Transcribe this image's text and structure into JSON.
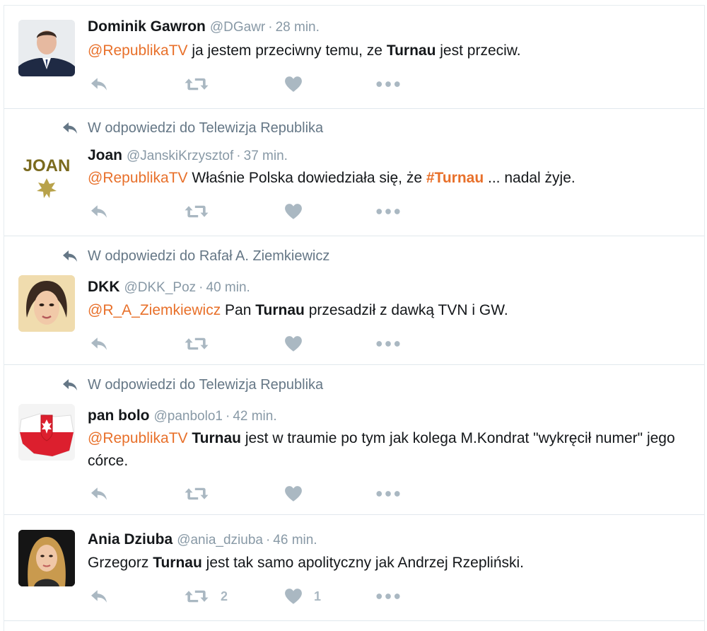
{
  "colors": {
    "accent": "#e8702a",
    "muted": "#8899a6",
    "icon": "#aab8c2",
    "divider": "#e1e8ed",
    "text": "#14171a"
  },
  "icons": {
    "reply": "reply-icon",
    "retweet": "retweet-icon",
    "like": "heart-icon",
    "more": "more-icon"
  },
  "tweets": [
    {
      "context": "",
      "fullname": "Dominik Gawron",
      "username": "@DGawr",
      "separator": "·",
      "time": "28 min.",
      "text": {
        "mention": "@RepublikaTV",
        "part1": " ja jestem przeciwny temu, ze ",
        "bold": "Turnau",
        "part2": " jest przeciw."
      },
      "retweets": "",
      "likes": ""
    },
    {
      "context": "W odpowiedzi do Telewizja Republika",
      "fullname": "Joan",
      "username": "@JanskiKrzysztof",
      "separator": "·",
      "time": "37 min.",
      "avatar_text": "JOAN",
      "text": {
        "mention": "@RepublikaTV",
        "part1": " Właśnie Polska dowiedziała się, że ",
        "hashtag": "#Turnau",
        "part2": " ... nadal żyje."
      },
      "retweets": "",
      "likes": ""
    },
    {
      "context": "W odpowiedzi do Rafał A. Ziemkiewicz",
      "fullname": "DKK",
      "username": "@DKK_Poz",
      "separator": "·",
      "time": "40 min.",
      "text": {
        "mention": "@R_A_Ziemkiewicz",
        "part1": " Pan ",
        "bold": "Turnau",
        "part2": " przesadził z dawką TVN i GW."
      },
      "retweets": "",
      "likes": ""
    },
    {
      "context": "W odpowiedzi do Telewizja Republika",
      "fullname": "pan bolo",
      "username": "@panbolo1",
      "separator": "·",
      "time": "42 min.",
      "text": {
        "mention": "@RepublikaTV",
        "part1": " ",
        "bold": "Turnau",
        "part2": " jest w traumie po tym jak kolega M.Kondrat \"wykręcił numer\" jego córce."
      },
      "retweets": "",
      "likes": ""
    },
    {
      "context": "",
      "fullname": "Ania Dziuba",
      "username": "@ania_dziuba",
      "separator": "·",
      "time": "46 min.",
      "text": {
        "part1": "Grzegorz ",
        "bold": "Turnau",
        "part2": " jest tak samo apolityczny jak Andrzej Rzepliński."
      },
      "retweets": "2",
      "likes": "1"
    }
  ]
}
